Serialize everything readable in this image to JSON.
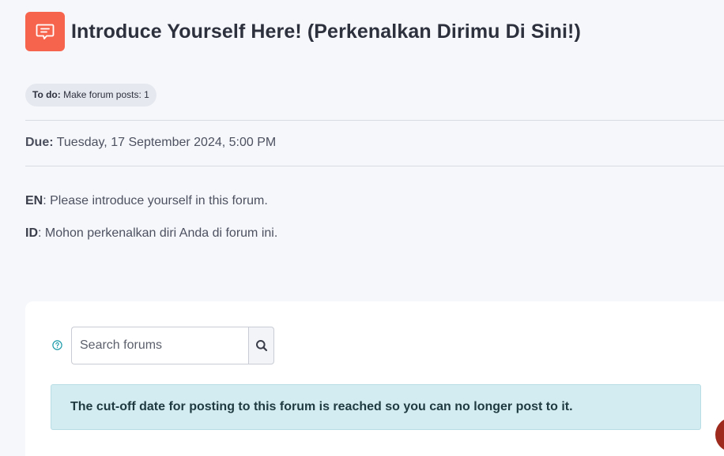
{
  "header": {
    "icon": "forum-icon",
    "title": "Introduce Yourself Here! (Perkenalkan Dirimu Di Sini!)",
    "accent_color": "#f7644d"
  },
  "todo": {
    "label": "To do:",
    "text": "Make forum posts: 1"
  },
  "due": {
    "label": "Due:",
    "value": "Tuesday, 17 September 2024, 5:00 PM"
  },
  "description": {
    "en_label": "EN",
    "en_text": ": Please introduce yourself in this forum.",
    "id_label": "ID",
    "id_text": ": Mohon perkenalkan diri Anda di forum ini."
  },
  "search": {
    "help_icon": "help-icon",
    "placeholder": "Search forums",
    "value": "",
    "button_icon": "search-icon"
  },
  "alert": {
    "text": "The cut-off date for posting to this forum is reached so you can no longer post to it.",
    "background_color": "#d2ecf1"
  }
}
